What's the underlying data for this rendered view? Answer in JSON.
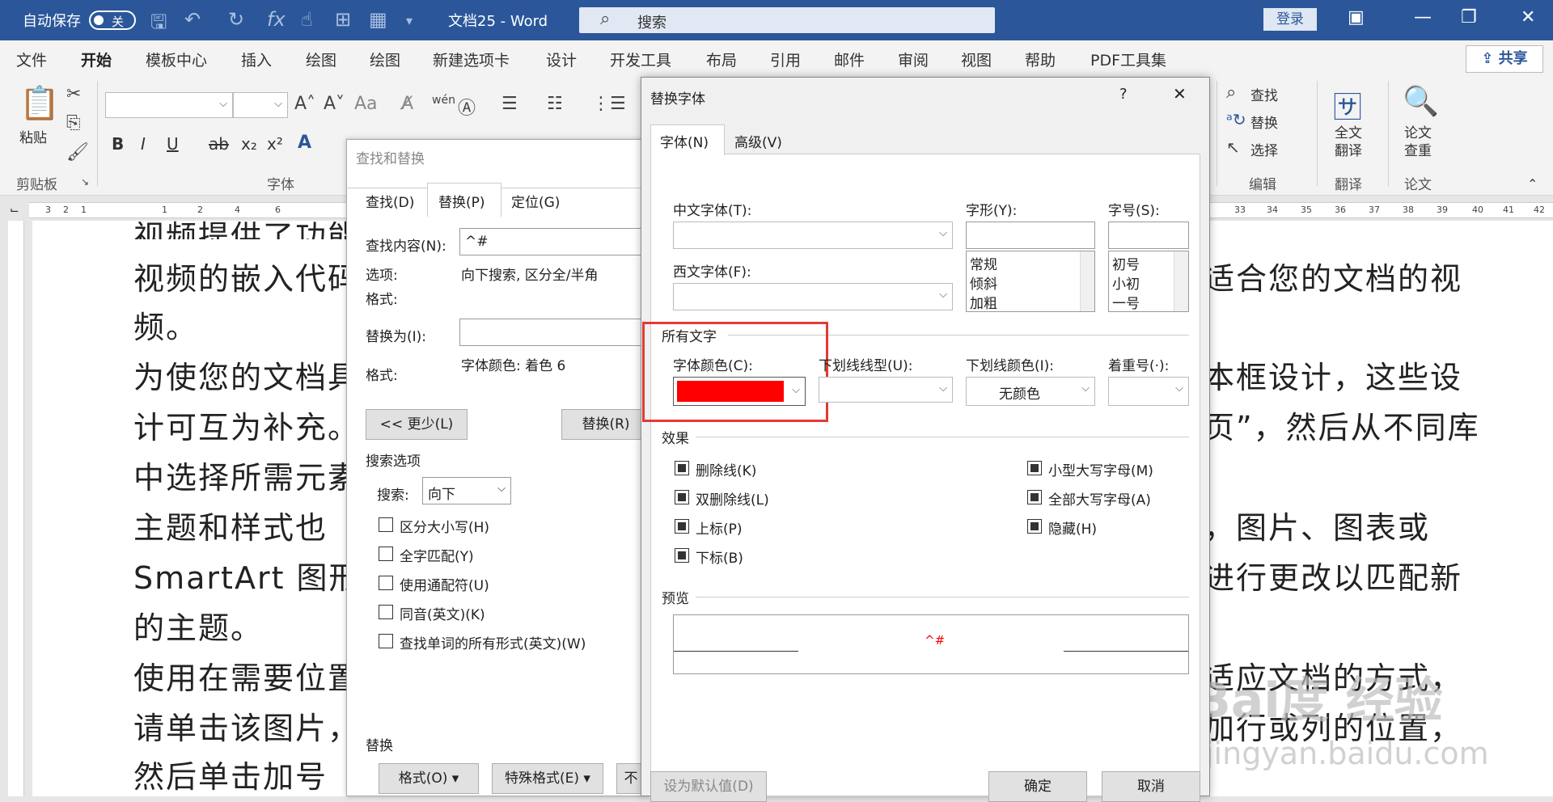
{
  "titlebar": {
    "autosave": "自动保存",
    "toggle": "关",
    "doc_title": "文档25  -  Word",
    "search_placeholder": "搜索",
    "login": "登录"
  },
  "tabs": [
    "文件",
    "开始",
    "模板中心",
    "插入",
    "绘图",
    "绘图",
    "新建选项卡",
    "设计",
    "开发工具",
    "布局",
    "引用",
    "邮件",
    "审阅",
    "视图",
    "帮助",
    "PDF工具集"
  ],
  "share": "共享",
  "ribbon": {
    "paste": "粘贴",
    "clipboard": "剪贴板",
    "font": "字体",
    "find": "查找",
    "replace": "替换",
    "select": "选择",
    "edit": "编辑",
    "translate_full": "全文翻译",
    "translate": "翻译",
    "paper_check": "论文查重",
    "paper": "论文",
    "bold": "B",
    "italic": "I",
    "underline": "U",
    "strike": "ab",
    "sub": "x₂",
    "sup": "x²"
  },
  "ruler": {
    "left": [
      "3",
      "2",
      "1",
      "1",
      "2",
      "1",
      "1",
      "2",
      "1",
      "4",
      "1",
      "6"
    ],
    "right": [
      "33",
      "34",
      "35",
      "36",
      "37",
      "38",
      "39",
      "40",
      "41",
      "42"
    ]
  },
  "document": {
    "left_lines": [
      "视频提供了功能",
      "视频的嵌入代码",
      "频。",
      "为使您的文档具",
      "计可互为补充。",
      "中选择所需元素",
      "主题和样式也",
      "SmartArt 图形",
      "的主题。",
      "使用在需要位置",
      "请单击该图片，",
      "然后单击加号"
    ],
    "right_lines": [
      "",
      "适合您的文档的视",
      "",
      "本框设计，这些设",
      "页”，然后从不同库",
      "",
      "，图片、图表或",
      "进行更改以匹配新",
      "",
      "适应文档的方式，",
      "加行或列的位置，",
      ""
    ]
  },
  "watermark": {
    "text": "Bai度 经验",
    "url": "jingyan.baidu.com"
  },
  "find_dialog": {
    "title": "查找和替换",
    "tabs": [
      "查找(D)",
      "替换(P)",
      "定位(G)"
    ],
    "find_label": "查找内容(N):",
    "find_value": "^#",
    "options_label": "选项:",
    "options_value": "向下搜索, 区分全/半角",
    "format_label": "格式:",
    "replace_label": "替换为(I):",
    "replace_value": "",
    "format_label2": "格式:",
    "format_value2": "字体颜色: 着色 6",
    "less_button": "<< 更少(L)",
    "replace_button": "替换(R)",
    "search_options": "搜索选项",
    "search_label": "搜索:",
    "search_value": "向下",
    "checkboxes": [
      "区分大小写(H)",
      "全字匹配(Y)",
      "使用通配符(U)",
      "同音(英文)(K)",
      "查找单词的所有形式(英文)(W)"
    ],
    "replace_section": "替换",
    "format_button": "格式(O)",
    "special_button": "特殊格式(E)",
    "no_format_button": "不"
  },
  "font_dialog": {
    "title": "替换字体",
    "help": "?",
    "close": "✕",
    "tabs": [
      "字体(N)",
      "高级(V)"
    ],
    "cn_font_label": "中文字体(T):",
    "west_font_label": "西文字体(F):",
    "style_label": "字形(Y):",
    "size_label": "字号(S):",
    "style_options": [
      "常规",
      "倾斜",
      "加粗"
    ],
    "size_options": [
      "初号",
      "小初",
      "一号"
    ],
    "all_text": "所有文字",
    "font_color_label": "字体颜色(C):",
    "underline_style_label": "下划线线型(U):",
    "underline_color_label": "下划线颜色(I):",
    "underline_color_value": "无颜色",
    "emphasis_label": "着重号(·):",
    "font_color_value": "#ff0000",
    "effects": "效果",
    "effects_left": [
      "删除线(K)",
      "双删除线(L)",
      "上标(P)",
      "下标(B)"
    ],
    "effects_right": [
      "小型大写字母(M)",
      "全部大写字母(A)",
      "隐藏(H)"
    ],
    "preview": "预览",
    "preview_text": "^#",
    "default_button": "设为默认值(D)",
    "ok_button": "确定",
    "cancel_button": "取消"
  },
  "highlight_color": "#e53935",
  "accent_color": "#2b579a"
}
